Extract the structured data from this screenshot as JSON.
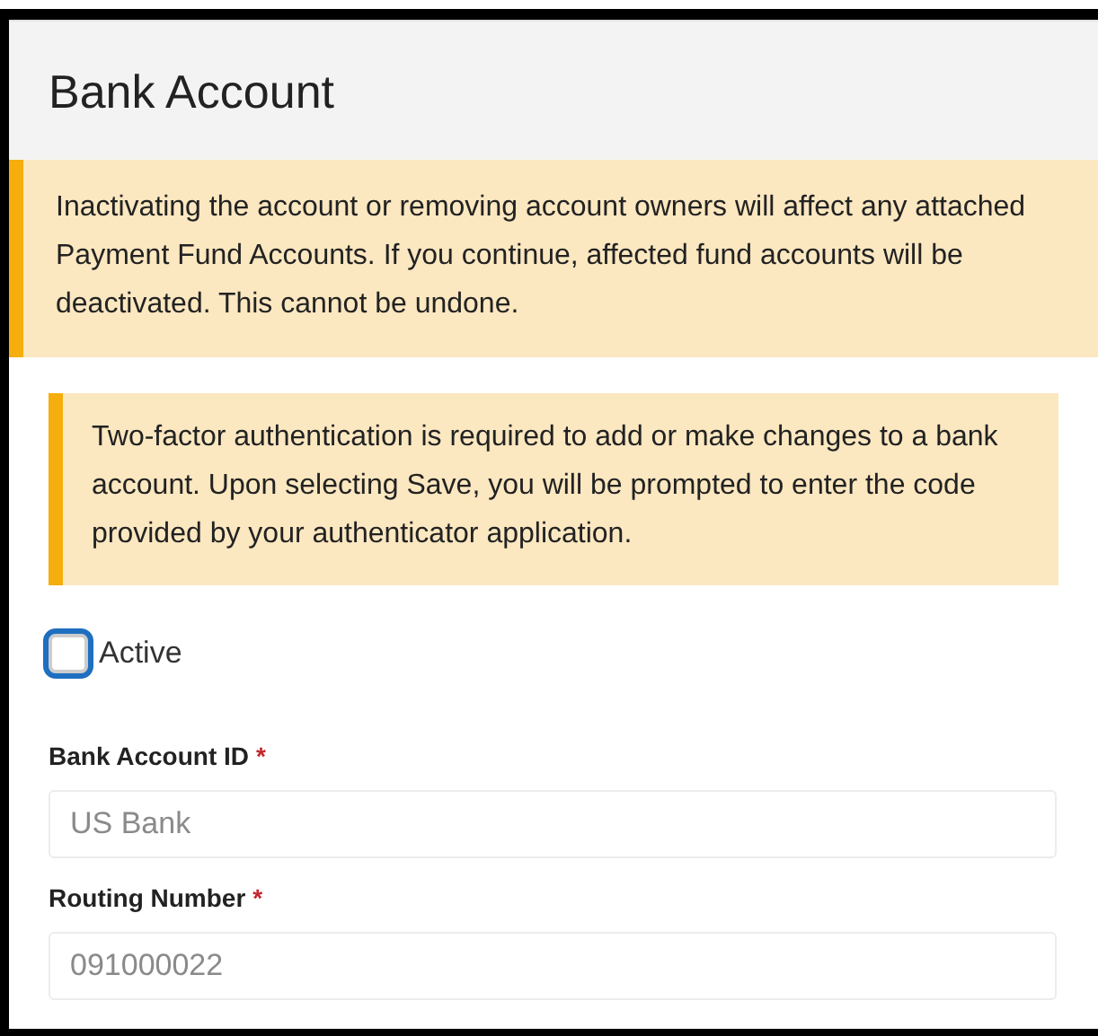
{
  "window": {
    "title": "Bank Account"
  },
  "alerts": [
    {
      "kind": "banner",
      "text": "Inactivating the account or removing account owners will affect any attached Payment Fund Accounts. If you continue, affected fund accounts will be deactivated. This cannot be undone."
    },
    {
      "kind": "inset",
      "text": "Two-factor authentication is required to add or make changes to a bank account. Upon selecting Save, you will be prompted to enter the code provided by your authenticator application."
    }
  ],
  "active": {
    "label": "Active",
    "checked": false
  },
  "fields": [
    {
      "label": "Bank Account ID",
      "required_mark": "*",
      "value": "US Bank"
    },
    {
      "label": "Routing Number",
      "required_mark": "*",
      "value": "091000022"
    }
  ]
}
